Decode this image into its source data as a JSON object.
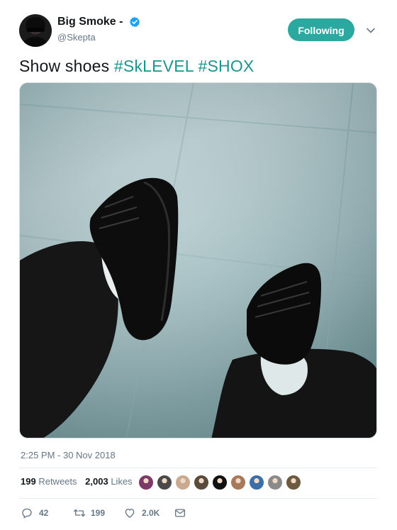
{
  "author": {
    "display_name": "Big Smoke -",
    "handle": "@Skepta",
    "verified": true
  },
  "follow_button": {
    "label": "Following"
  },
  "tweet": {
    "text_plain": "Show shoes",
    "hashtags": [
      "#SkLEVEL",
      "#SHOX"
    ]
  },
  "timestamp": "2:25 PM - 30 Nov 2018",
  "stats": {
    "retweets_count": "199",
    "retweets_label": "Retweets",
    "likes_count": "2,003",
    "likes_label": "Likes"
  },
  "likers": [
    {
      "icon": "avatar",
      "color": "#7c3a68"
    },
    {
      "icon": "avatar",
      "color": "#4a4a4a"
    },
    {
      "icon": "avatar",
      "color": "#c9a98f"
    },
    {
      "icon": "avatar",
      "color": "#5a4a3a"
    },
    {
      "icon": "avatar",
      "color": "#111111"
    },
    {
      "icon": "avatar",
      "color": "#a67a5b"
    },
    {
      "icon": "avatar",
      "color": "#3b6fa8"
    },
    {
      "icon": "avatar",
      "color": "#8a8a8a"
    },
    {
      "icon": "avatar",
      "color": "#6b5a3e"
    }
  ],
  "actions": {
    "reply_count": "42",
    "retweet_count": "199",
    "like_count": "2.0K"
  },
  "colors": {
    "accent": "#2ba9a0",
    "hashtag": "#1b958d",
    "secondary_text": "#657786",
    "verified": "#1da1f2"
  }
}
